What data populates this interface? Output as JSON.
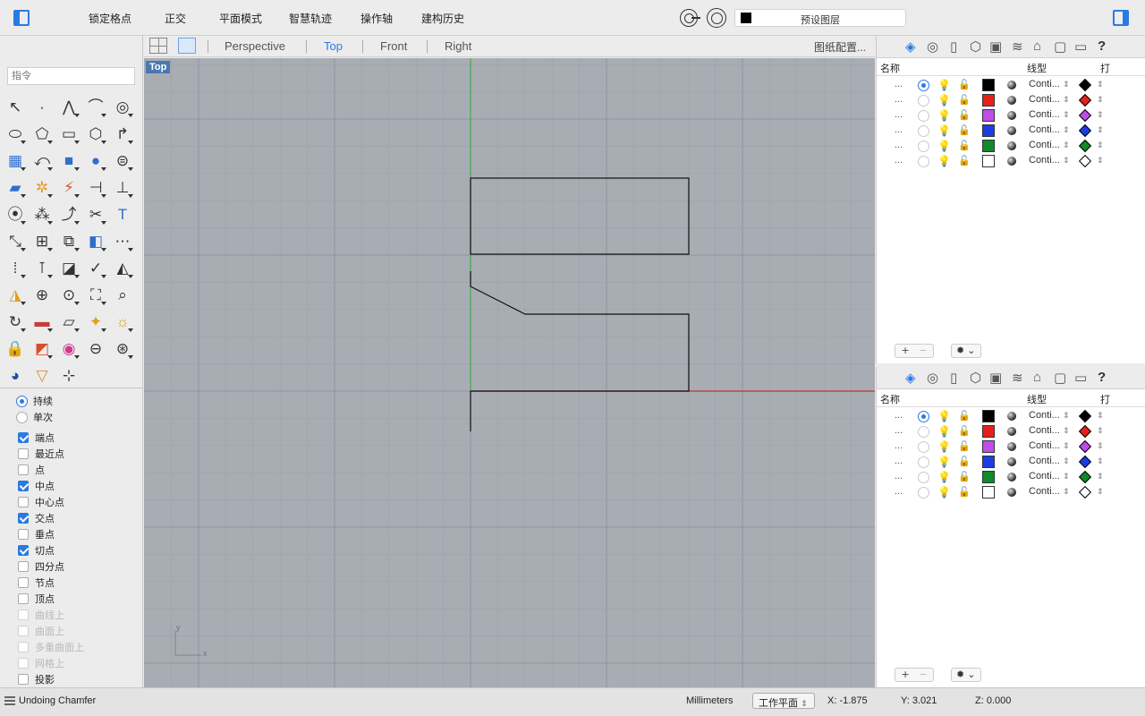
{
  "toolbar": {
    "items": [
      "锁定格点",
      "正交",
      "平面模式",
      "智慧轨迹",
      "操作轴",
      "建构历史"
    ],
    "default_layer": "预设图层"
  },
  "left_panel": {
    "command_placeholder": "指令",
    "tools": [
      "select-arrow",
      "point",
      "polyline",
      "curve",
      "circle",
      "ellipse",
      "polygon",
      "rectangle",
      "arc-polygon",
      "fillet",
      "surface",
      "sweep",
      "box",
      "sphere",
      "cylinder",
      "extrude",
      "explode",
      "boolean",
      "dimension",
      "align",
      "blend",
      "join",
      "curve-tools",
      "trim",
      "text",
      "transform",
      "group",
      "array",
      "solid",
      "mesh",
      "grid-array",
      "distance",
      "lasso",
      "check",
      "analyze",
      "render-tools",
      "zoom",
      "zoom-window",
      "zoom-extents",
      "zoom-target",
      "rotate-view",
      "car",
      "plane",
      "display",
      "light",
      "lock",
      "material",
      "color-wheel",
      "sphere-2",
      "wire-sphere",
      "environment",
      "projector",
      "snap-settings"
    ],
    "snap_modes": [
      {
        "label": "持续",
        "type": "radio",
        "on": true
      },
      {
        "label": "单次",
        "type": "radio",
        "on": false
      }
    ],
    "osnaps": [
      {
        "label": "端点",
        "checked": true,
        "enabled": true
      },
      {
        "label": "最近点",
        "checked": false,
        "enabled": true
      },
      {
        "label": "点",
        "checked": false,
        "enabled": true
      },
      {
        "label": "中点",
        "checked": true,
        "enabled": true
      },
      {
        "label": "中心点",
        "checked": false,
        "enabled": true
      },
      {
        "label": "交点",
        "checked": true,
        "enabled": true
      },
      {
        "label": "垂点",
        "checked": false,
        "enabled": true
      },
      {
        "label": "切点",
        "checked": true,
        "enabled": true
      },
      {
        "label": "四分点",
        "checked": false,
        "enabled": true
      },
      {
        "label": "节点",
        "checked": false,
        "enabled": true
      },
      {
        "label": "顶点",
        "checked": false,
        "enabled": true
      },
      {
        "label": "曲线上",
        "checked": false,
        "enabled": false
      },
      {
        "label": "曲面上",
        "checked": false,
        "enabled": false
      },
      {
        "label": "多重曲面上",
        "checked": false,
        "enabled": false
      },
      {
        "label": "网格上",
        "checked": false,
        "enabled": false
      },
      {
        "label": "投影",
        "checked": false,
        "enabled": true
      }
    ]
  },
  "viewport_tabs": {
    "tabs": [
      "Perspective",
      "Top",
      "Front",
      "Right"
    ],
    "active": "Top",
    "layout_button": "图纸配置..."
  },
  "viewport": {
    "label": "Top",
    "axis_x": "x",
    "axis_y": "y",
    "grid_color": "#9ea3aa",
    "background": "#a8adb4"
  },
  "layers_panel": {
    "col_name": "名称",
    "col_linetype": "线型",
    "col_print": "打",
    "linetype_label": "Conti...",
    "layers": [
      {
        "color": "#000000",
        "current": true,
        "dim": true
      },
      {
        "color": "#e8201b",
        "current": false,
        "dim": false
      },
      {
        "color": "#c04de9",
        "current": false,
        "dim": false
      },
      {
        "color": "#1d3de4",
        "current": false,
        "dim": false
      },
      {
        "color": "#108a2a",
        "current": false,
        "dim": false
      },
      {
        "color": "#ffffff",
        "current": false,
        "dim": false
      }
    ],
    "add_label": "+",
    "remove_label": "−",
    "gear_label": "✹ ⌄"
  },
  "statusbar": {
    "message": "Undoing Chamfer",
    "units": "Millimeters",
    "cplane": "工作平面",
    "x": "X: -1.875",
    "y": "Y: 3.021",
    "z": "Z: 0.000"
  }
}
